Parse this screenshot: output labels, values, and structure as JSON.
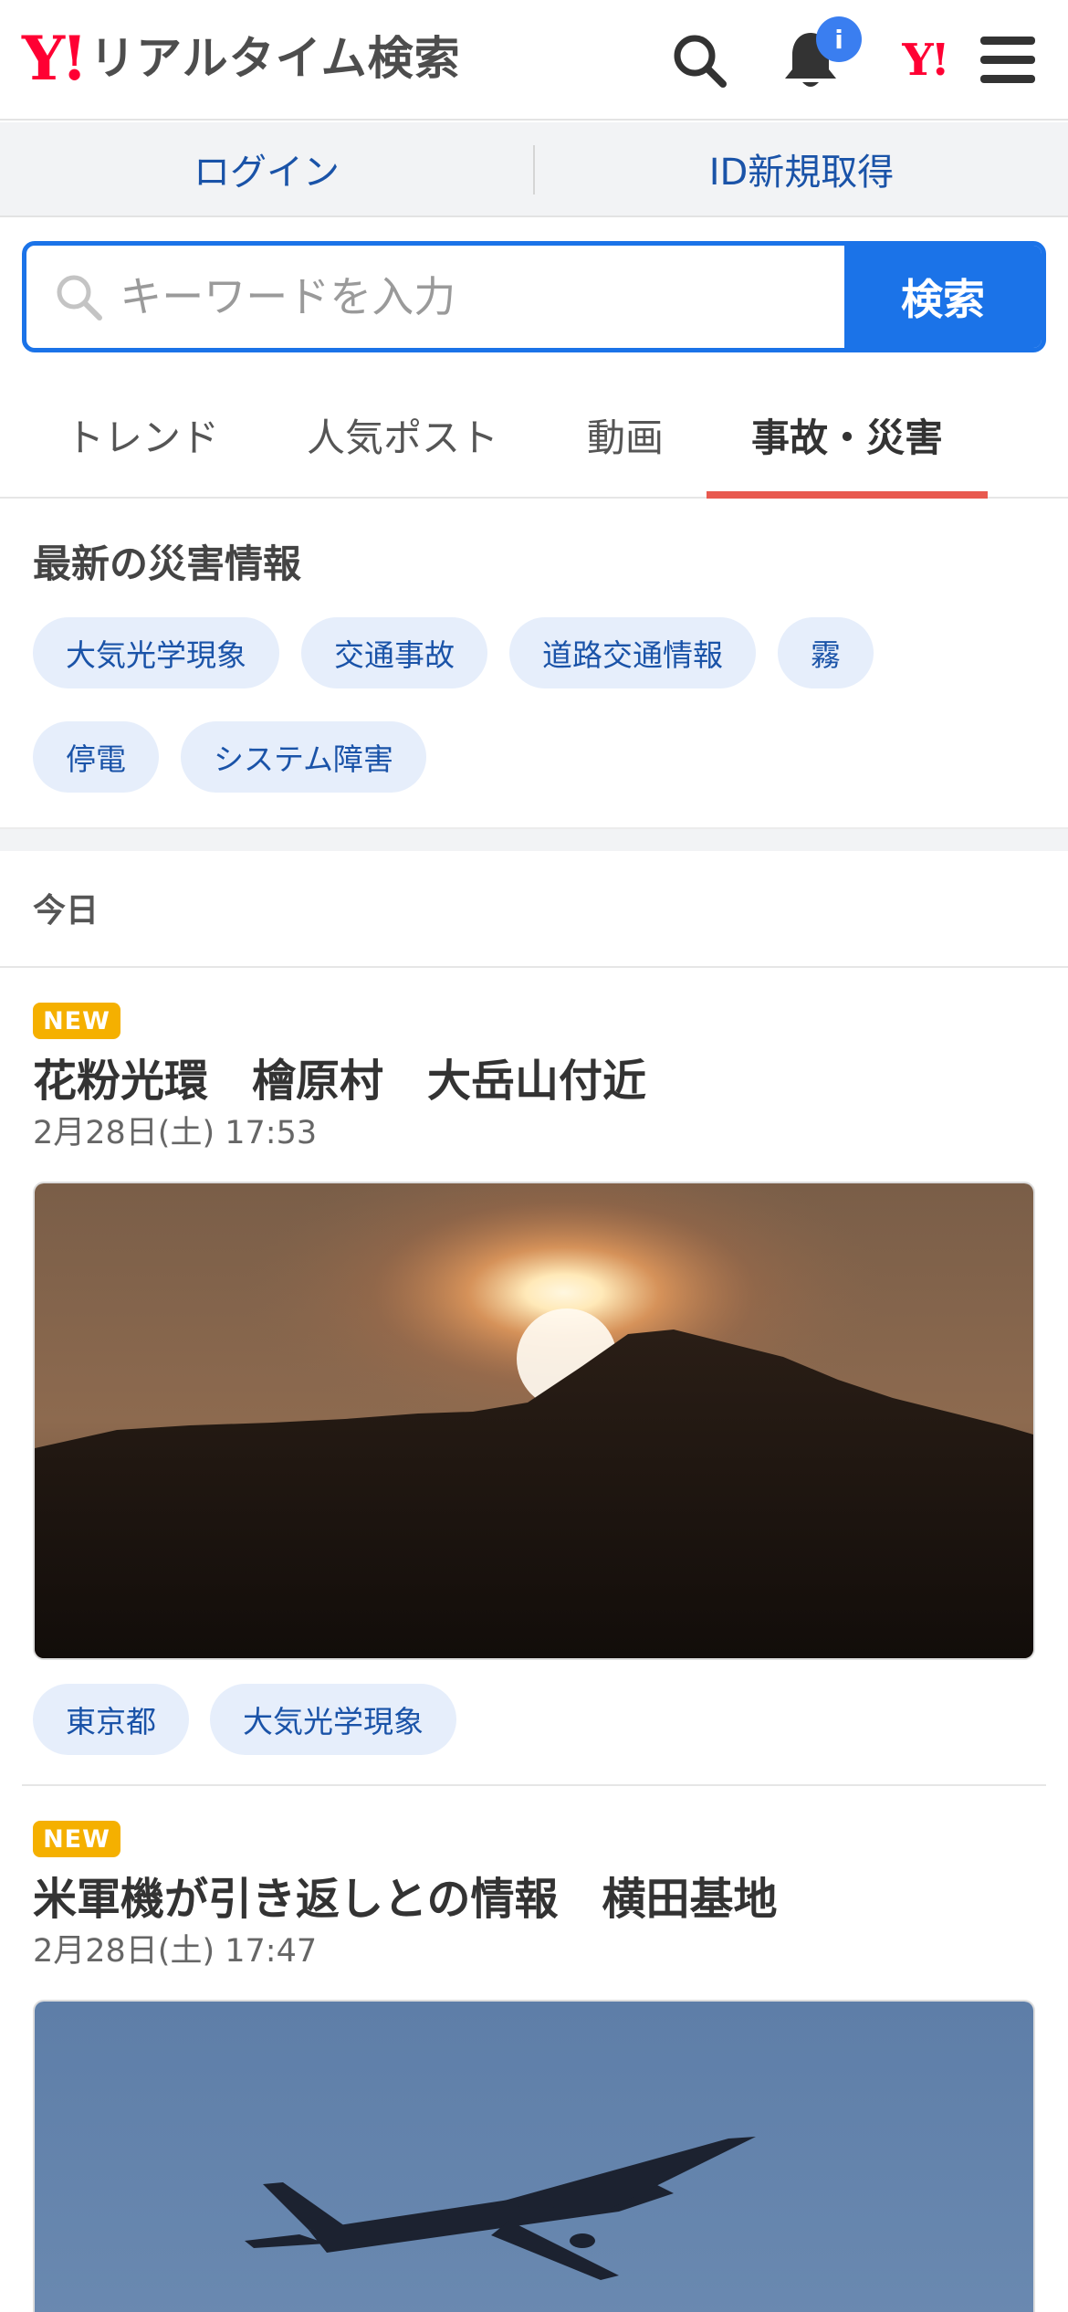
{
  "header": {
    "logo_mark": "Y!",
    "logo_text": "リアルタイム検索",
    "notification_badge": "i",
    "yjapan_mark": "Y!"
  },
  "auth": {
    "login": "ログイン",
    "signup": "ID新規取得"
  },
  "search": {
    "placeholder": "キーワードを入力",
    "button": "検索"
  },
  "tabs": [
    {
      "label": "トレンド",
      "active": false
    },
    {
      "label": "人気ポスト",
      "active": false
    },
    {
      "label": "動画",
      "active": false
    },
    {
      "label": "事故・災害",
      "active": true
    }
  ],
  "disaster": {
    "title": "最新の災害情報",
    "chips": [
      "大気光学現象",
      "交通事故",
      "道路交通情報",
      "霧",
      "停電",
      "システム障害"
    ]
  },
  "feed": {
    "day_label": "今日",
    "articles": [
      {
        "badge": "NEW",
        "title": "花粉光環　檜原村　大岳山付近",
        "time": "2月28日(土) 17:53",
        "tags": [
          "東京都",
          "大気光学現象"
        ]
      },
      {
        "badge": "NEW",
        "title": "米軍機が引き返しとの情報　横田基地",
        "time": "2月28日(土) 17:47",
        "tags": []
      }
    ]
  },
  "colors": {
    "brand_red": "#ff0033",
    "accent_blue": "#1b73e8",
    "link_blue": "#1a53a8",
    "tab_underline": "#e8594f",
    "new_badge": "#f5b000",
    "chip_bg": "#e6eefb"
  },
  "icons": [
    "search-icon",
    "bell-icon",
    "menu-icon"
  ]
}
